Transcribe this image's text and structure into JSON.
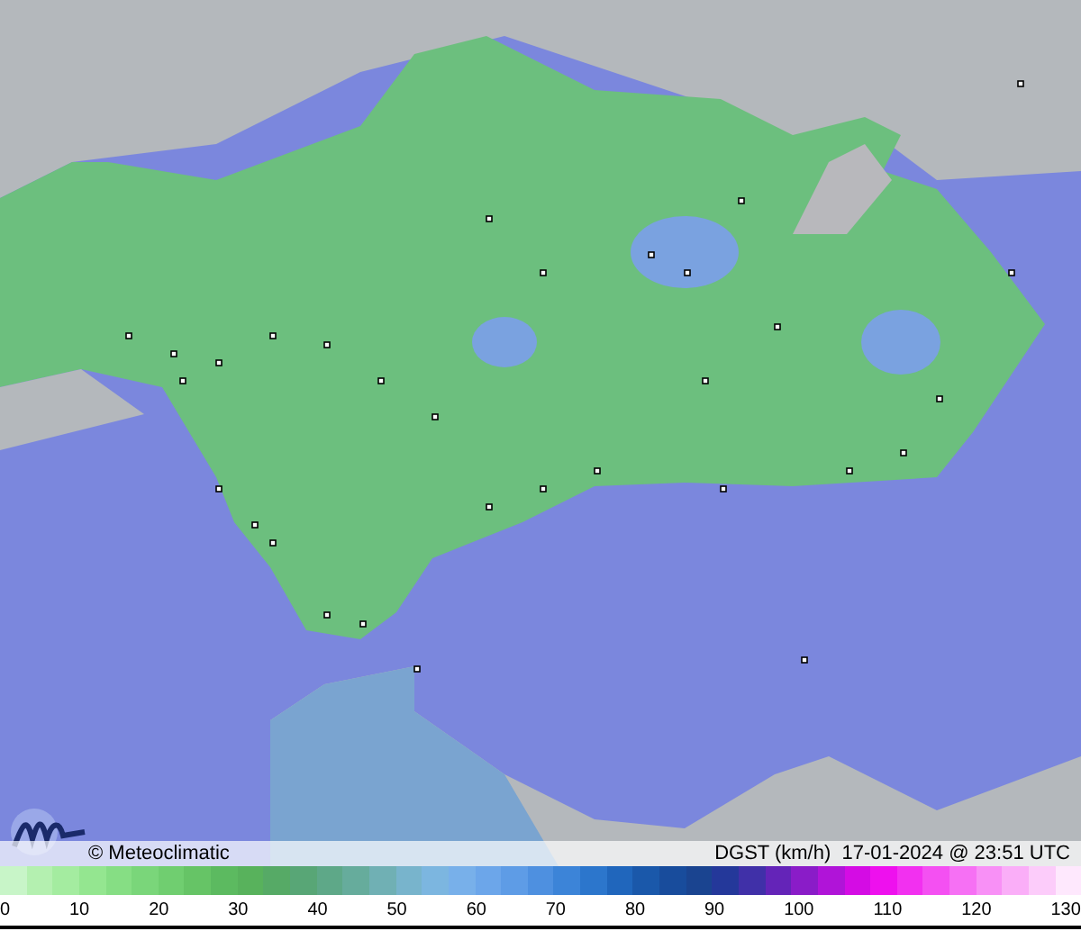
{
  "map": {
    "credit": "© Meteoclimatic",
    "caption": "DGST (km/h)  17-01-2024 @ 23:51 UTC"
  },
  "legend": {
    "ticks": [
      "0",
      "10",
      "20",
      "30",
      "40",
      "50",
      "60",
      "70",
      "80",
      "90",
      "100",
      "110",
      "120",
      "130"
    ]
  }
}
